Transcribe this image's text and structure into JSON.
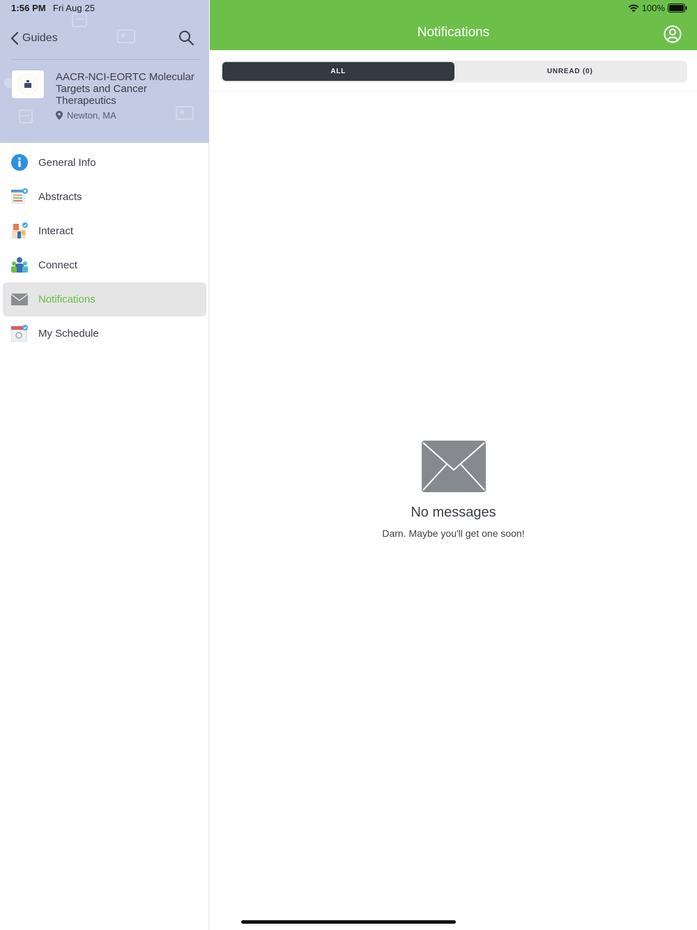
{
  "status_bar": {
    "time": "1:56 PM",
    "date": "Fri Aug 25",
    "battery": "100%"
  },
  "sidebar": {
    "back_label": "Guides",
    "event": {
      "title": "AACR-NCI-EORTC Molecular Targets and Cancer Therapeutics",
      "location": "Newton, MA"
    },
    "items": [
      {
        "label": "General Info",
        "icon": "info-icon"
      },
      {
        "label": "Abstracts",
        "icon": "abstracts-icon"
      },
      {
        "label": "Interact",
        "icon": "interact-icon"
      },
      {
        "label": "Connect",
        "icon": "connect-icon"
      },
      {
        "label": "Notifications",
        "icon": "envelope-icon",
        "active": true
      },
      {
        "label": "My Schedule",
        "icon": "calendar-icon"
      }
    ]
  },
  "main": {
    "title": "Notifications",
    "tabs": [
      {
        "label": "ALL",
        "active": true
      },
      {
        "label": "UNREAD (0)",
        "active": false
      }
    ],
    "empty_state": {
      "title": "No messages",
      "subtitle": "Darn. Maybe you'll get one soon!"
    }
  },
  "colors": {
    "accent_green": "#6cc04a",
    "sidebar_header": "#c3cae4",
    "active_tab": "#333a41"
  }
}
